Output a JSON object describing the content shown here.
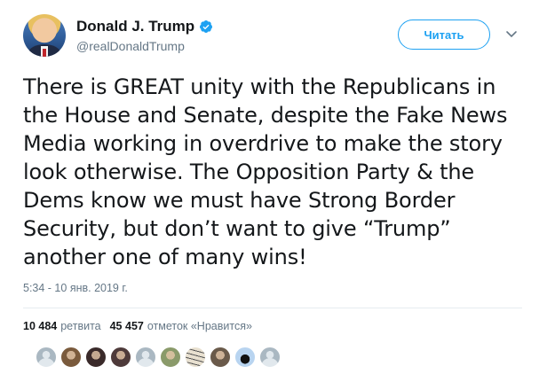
{
  "user": {
    "name": "Donald J. Trump",
    "handle": "@realDonaldTrump"
  },
  "follow_button": {
    "label": "Читать",
    "color": "#1da1f2"
  },
  "tweet": {
    "text": "There is GREAT unity with the Republicans in\nthe House and Senate, despite the Fake News\nMedia working in overdrive to make the story\nlook otherwise. The Opposition Party & the\nDems know we must have Strong Border\nSecurity, but don’t want to give “Trump”\nanother one of many wins!",
    "timestamp": "5:34 - 10 янв. 2019 г."
  },
  "stats": {
    "retweets_count": "10 484",
    "retweets_label": "ретвита",
    "likes_count": "45 457",
    "likes_label": "отметок «Нравится»"
  },
  "likers": [
    {
      "icon": "default-avatar",
      "color": "#aab8c2"
    },
    {
      "icon": "photo-avatar",
      "color": "#7a5a3c"
    },
    {
      "icon": "photo-avatar",
      "color": "#3a2a2a"
    },
    {
      "icon": "photo-avatar",
      "color": "#4e3a3a"
    },
    {
      "icon": "default-avatar",
      "color": "#aab8c2"
    },
    {
      "icon": "photo-avatar",
      "color": "#8a9a6a"
    },
    {
      "icon": "text-avatar",
      "color": "#e8e0d0"
    },
    {
      "icon": "photo-avatar",
      "color": "#6a5a4a"
    },
    {
      "icon": "horse-avatar",
      "color": "#b8d4f0"
    },
    {
      "icon": "default-avatar",
      "color": "#aab8c2"
    }
  ],
  "colors": {
    "text": "#14171a",
    "secondary": "#657786",
    "verified": "#1da1f2"
  }
}
